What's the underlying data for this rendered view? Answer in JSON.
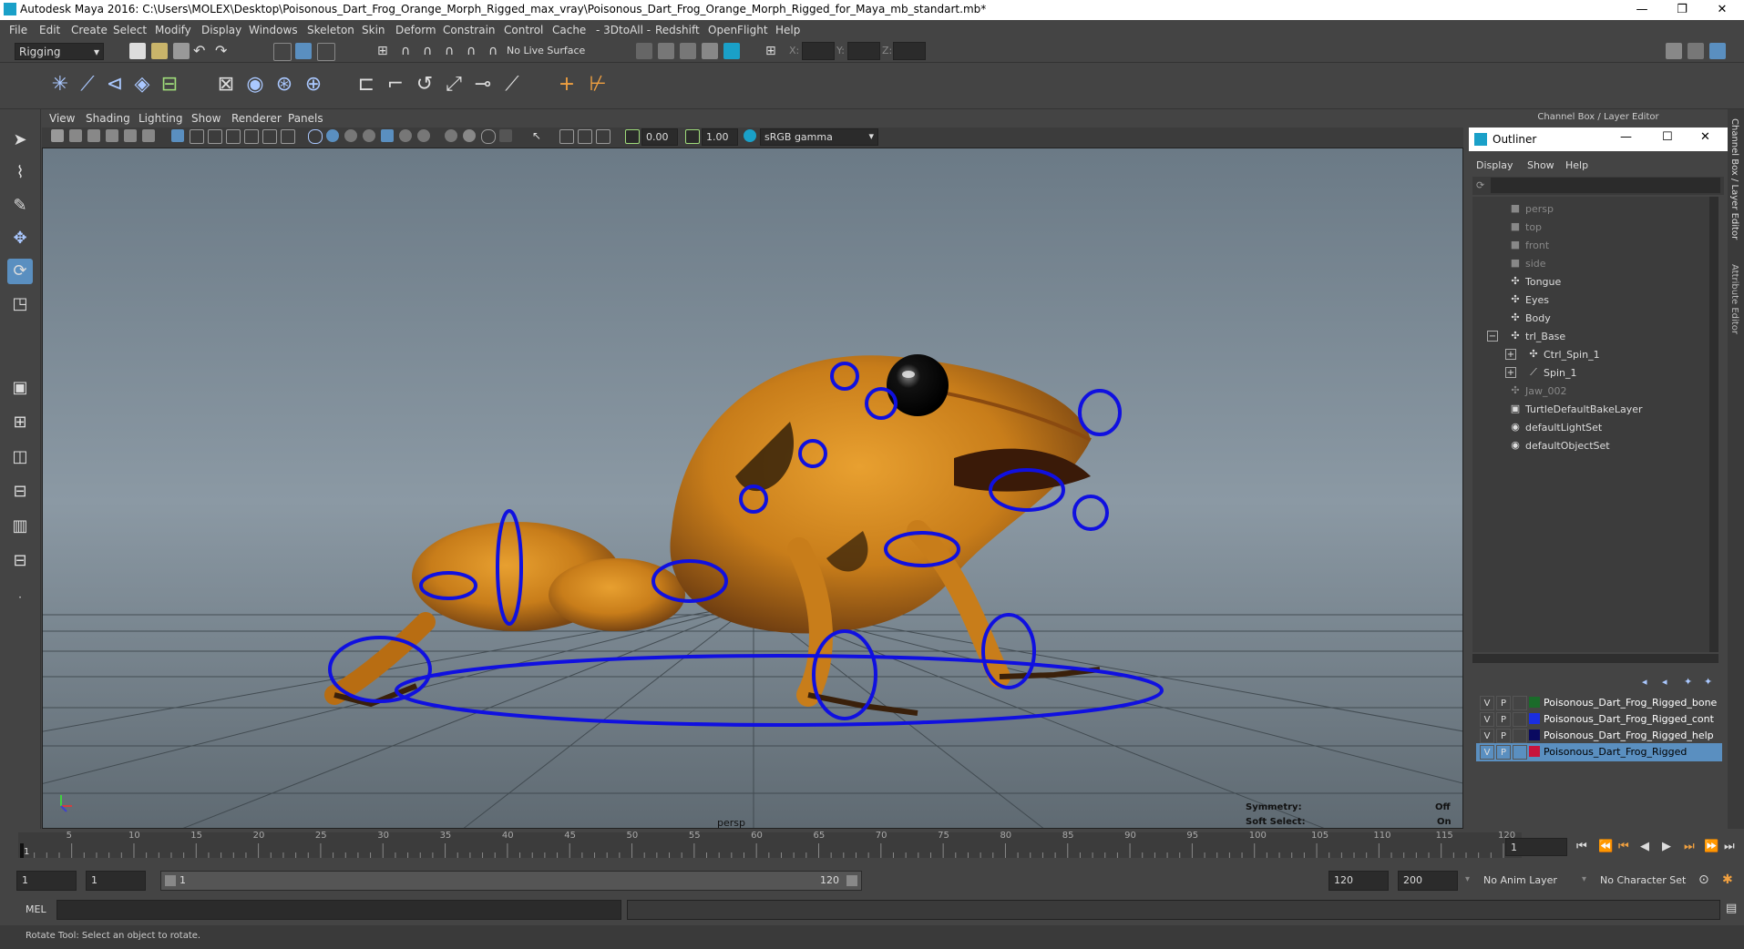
{
  "window": {
    "title": "Autodesk Maya 2016: C:\\Users\\MOLEX\\Desktop\\Poisonous_Dart_Frog_Orange_Morph_Rigged_max_vray\\Poisonous_Dart_Frog_Orange_Morph_Rigged_for_Maya_mb_standart.mb*",
    "minimize": "—",
    "restore": "❐",
    "close": "✕"
  },
  "menubar": [
    "File",
    "Edit",
    "Create",
    "Select",
    "Modify",
    "Display",
    "Windows",
    "Skeleton",
    "Skin",
    "Deform",
    "Constrain",
    "Control",
    "Cache",
    "- 3DtoAll -",
    "Redshift",
    "OpenFlight",
    "Help"
  ],
  "status": {
    "mode": "Rigging",
    "live_surface": "No Live Surface",
    "x_label": "X:",
    "y_label": "Y:",
    "z_label": "Z:"
  },
  "viewport": {
    "menus": [
      "View",
      "Shading",
      "Lighting",
      "Show",
      "Renderer",
      "Panels"
    ],
    "exposure": "0.00",
    "gamma": "1.00",
    "color_space": "sRGB gamma",
    "camera_label": "persp",
    "symmetry_label": "Symmetry:",
    "symmetry_value": "Off",
    "soft_select_label": "Soft Select:",
    "soft_select_value": "On"
  },
  "channel_box_title": "Channel Box / Layer Editor",
  "side_tabs": [
    "Channel Box / Layer Editor",
    "Attribute Editor"
  ],
  "outliner": {
    "title": "Outliner",
    "menus": [
      "Display",
      "Show",
      "Help"
    ],
    "items": [
      {
        "label": "persp",
        "icon": "camera-icon",
        "dim": true,
        "indent": 0,
        "expander": ""
      },
      {
        "label": "top",
        "icon": "camera-icon",
        "dim": true,
        "indent": 0,
        "expander": ""
      },
      {
        "label": "front",
        "icon": "camera-icon",
        "dim": true,
        "indent": 0,
        "expander": ""
      },
      {
        "label": "side",
        "icon": "camera-icon",
        "dim": true,
        "indent": 0,
        "expander": ""
      },
      {
        "label": "Tongue",
        "icon": "transform-icon",
        "dim": false,
        "indent": 0,
        "expander": ""
      },
      {
        "label": "Eyes",
        "icon": "transform-icon",
        "dim": false,
        "indent": 0,
        "expander": ""
      },
      {
        "label": "Body",
        "icon": "transform-icon",
        "dim": false,
        "indent": 0,
        "expander": ""
      },
      {
        "label": "trl_Base",
        "icon": "transform-icon",
        "dim": false,
        "indent": 0,
        "expander": "−"
      },
      {
        "label": "Ctrl_Spin_1",
        "icon": "transform-icon",
        "dim": false,
        "indent": 1,
        "expander": "+"
      },
      {
        "label": "Spin_1",
        "icon": "joint-icon",
        "dim": false,
        "indent": 1,
        "expander": "+"
      },
      {
        "label": "Jaw_002",
        "icon": "transform-icon",
        "dim": true,
        "indent": 0,
        "expander": ""
      },
      {
        "label": "TurtleDefaultBakeLayer",
        "icon": "bake-layer-icon",
        "dim": false,
        "indent": 0,
        "expander": ""
      },
      {
        "label": "defaultLightSet",
        "icon": "set-icon",
        "dim": false,
        "indent": 0,
        "expander": ""
      },
      {
        "label": "defaultObjectSet",
        "icon": "set-icon",
        "dim": false,
        "indent": 0,
        "expander": ""
      }
    ]
  },
  "layers": [
    {
      "v": "V",
      "p": "P",
      "name": "Poisonous_Dart_Frog_Rigged_bone",
      "color": "#1a6b2a",
      "selected": false
    },
    {
      "v": "V",
      "p": "P",
      "name": "Poisonous_Dart_Frog_Rigged_cont",
      "color": "#1a2ee0",
      "selected": false
    },
    {
      "v": "V",
      "p": "P",
      "name": "Poisonous_Dart_Frog_Rigged_help",
      "color": "#0a0a60",
      "selected": false
    },
    {
      "v": "V",
      "p": "P",
      "name": "Poisonous_Dart_Frog_Rigged",
      "color": "#c8143c",
      "selected": true
    }
  ],
  "timeline": {
    "ticks": [
      "5",
      "10",
      "15",
      "20",
      "25",
      "30",
      "35",
      "40",
      "45",
      "50",
      "55",
      "60",
      "65",
      "70",
      "75",
      "80",
      "85",
      "90",
      "95",
      "100",
      "105",
      "110",
      "115",
      "120"
    ],
    "start_tick": "1",
    "current_frame": "1"
  },
  "range": {
    "start": "1",
    "playback_start": "1",
    "slider_start": "1",
    "slider_end": "120",
    "playback_end": "120",
    "end": "200",
    "anim_layer": "No Anim Layer",
    "character_set": "No Character Set"
  },
  "command": {
    "label": "MEL"
  },
  "help_text": "Rotate Tool: Select an object to rotate.",
  "colors": {
    "accent": "#1aa0c8",
    "selection": "#5a8fc0",
    "controls": "#1010e0"
  }
}
